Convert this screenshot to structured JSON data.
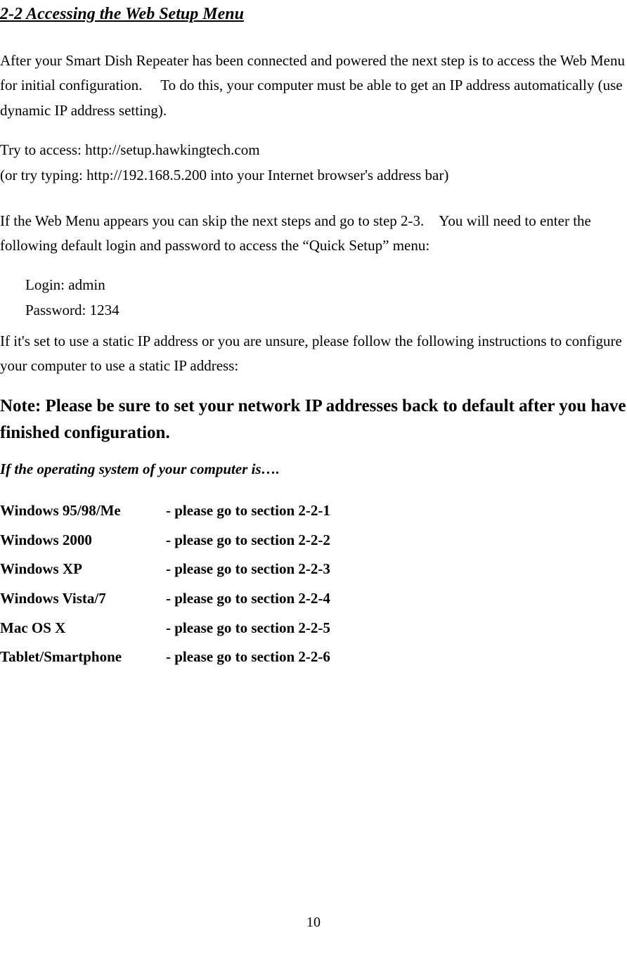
{
  "section_title": "2-2 Accessing the Web Setup Menu",
  "para1": "After your Smart Dish Repeater has been connected and powered the next step is to access the Web Menu for initial configuration.  To do this, your computer must be able to get an IP address automatically (use dynamic IP address setting).",
  "para2_line1": "Try to access: http://setup.hawkingtech.com",
  "para2_line2": "(or try typing: http://192.168.5.200 into your Internet browser's address bar)",
  "para3": "If the Web Menu appears you can skip the next steps and go to step 2-3. You will need to enter the following default login and password to access the “Quick Setup” menu:",
  "login_line": "Login: admin",
  "password_line": "Password: 1234",
  "para4": "If it's set to use a static IP address or you are unsure, please follow the following instructions to configure your computer to use a static IP address:",
  "note": "Note: Please be sure to set your network IP addresses back to default after you have finished configuration.",
  "os_prompt": "If the operating system of your computer is….",
  "os_list": [
    {
      "name": "Windows 95/98/Me",
      "target": "- please go to section 2-2-1"
    },
    {
      "name": "Windows 2000",
      "target": "- please go to section 2-2-2"
    },
    {
      "name": "Windows XP",
      "target": "- please go to section 2-2-3"
    },
    {
      "name": "Windows Vista/7",
      "target": "- please go to section 2-2-4"
    },
    {
      "name": "Mac OS X",
      "target": "- please go to section 2-2-5"
    },
    {
      "name": "Tablet/Smartphone",
      "target": "- please go to section 2-2-6"
    }
  ],
  "page_number": "10"
}
